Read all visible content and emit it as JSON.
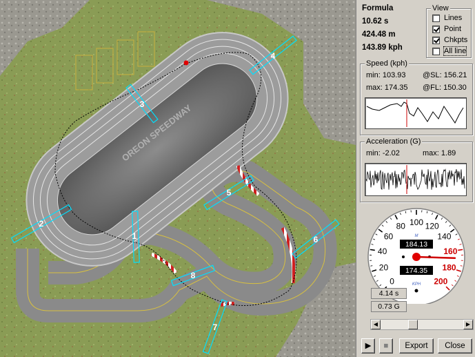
{
  "track": {
    "name": "OREON SPEEDWAY",
    "checkpoints": [
      "1",
      "2",
      "3",
      "4",
      "5",
      "6",
      "7",
      "8"
    ]
  },
  "info": {
    "car": "Formula",
    "time": "10.62 s",
    "distance": "424.48 m",
    "speed": "143.89 kph"
  },
  "view": {
    "title": "View",
    "options": [
      {
        "label": "Lines",
        "checked": false
      },
      {
        "label": "Point",
        "checked": true
      },
      {
        "label": "Chkpts",
        "checked": true
      },
      {
        "label": "All line",
        "checked": false
      }
    ]
  },
  "speed_panel": {
    "title": "Speed (kph)",
    "min": "min: 103.93",
    "max": "max: 174.35",
    "sl": "@SL: 156.21",
    "fl": "@FL: 150.30"
  },
  "accel_panel": {
    "title": "Acceleration (G)",
    "min": "min: -2.02",
    "max": "max: 1.89"
  },
  "speedometer": {
    "unit": "KPH",
    "unit_small": "M",
    "ticks": [
      "0",
      "20",
      "40",
      "60",
      "80",
      "100",
      "120",
      "140",
      "160",
      "180",
      "200"
    ],
    "top_readout": "184.13",
    "bottom_readout": "174.35",
    "needle_value": 168
  },
  "lap_time": "4.14 s",
  "g_force": "0.73 G",
  "buttons": {
    "play": "▶",
    "stop": "■",
    "export": "Export",
    "close": "Close"
  },
  "colors": {
    "accent_red": "#cc0000",
    "checkpoint": "#00e0ff"
  }
}
